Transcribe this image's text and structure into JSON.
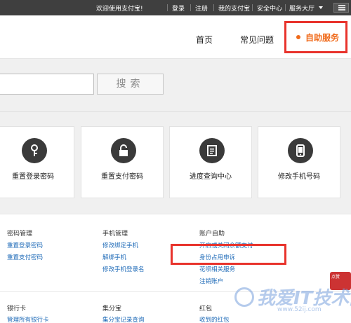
{
  "topbar": {
    "welcome": "欢迎使用支付宝!",
    "login": "登录",
    "register": "注册",
    "my_alipay": "我的支付宝",
    "security": "安全中心",
    "service_hall": "服务大厅"
  },
  "nav": {
    "home": "首页",
    "faq": "常见问题",
    "self_service": "自助服务"
  },
  "search": {
    "value": "",
    "button": "搜索"
  },
  "tiles": [
    {
      "label": "重置登录密码",
      "icon": "key-icon"
    },
    {
      "label": "重置支付密码",
      "icon": "lock-icon"
    },
    {
      "label": "进度查询中心",
      "icon": "document-icon"
    },
    {
      "label": "修改手机号码",
      "icon": "phone-icon"
    }
  ],
  "sections": {
    "password": {
      "title": "密码管理",
      "links": [
        "重置登录密码",
        "重置支付密码"
      ]
    },
    "mobile": {
      "title": "手机管理",
      "links": [
        "修改绑定手机",
        "解绑手机",
        "修改手机登录名"
      ]
    },
    "account": {
      "title": "账户自助",
      "links": [
        "开启或关闭余额支付",
        "身份占用申诉",
        "花呗相关服务",
        "注销账户"
      ]
    },
    "bankcard": {
      "title": "银行卡",
      "links": [
        "管理所有银行卡"
      ]
    },
    "jifenbao": {
      "title": "集分宝",
      "links": [
        "集分宝记录查询"
      ]
    },
    "redpacket": {
      "title": "红包",
      "links": [
        "收到的红包"
      ]
    }
  },
  "watermark": {
    "text": "我爱IT技术网",
    "url": "www.52ij.com"
  },
  "badge": {
    "text": "点赞"
  },
  "colors": {
    "accent": "#f06a1a",
    "highlight": "#e8332c",
    "link": "#1f6bb8"
  }
}
